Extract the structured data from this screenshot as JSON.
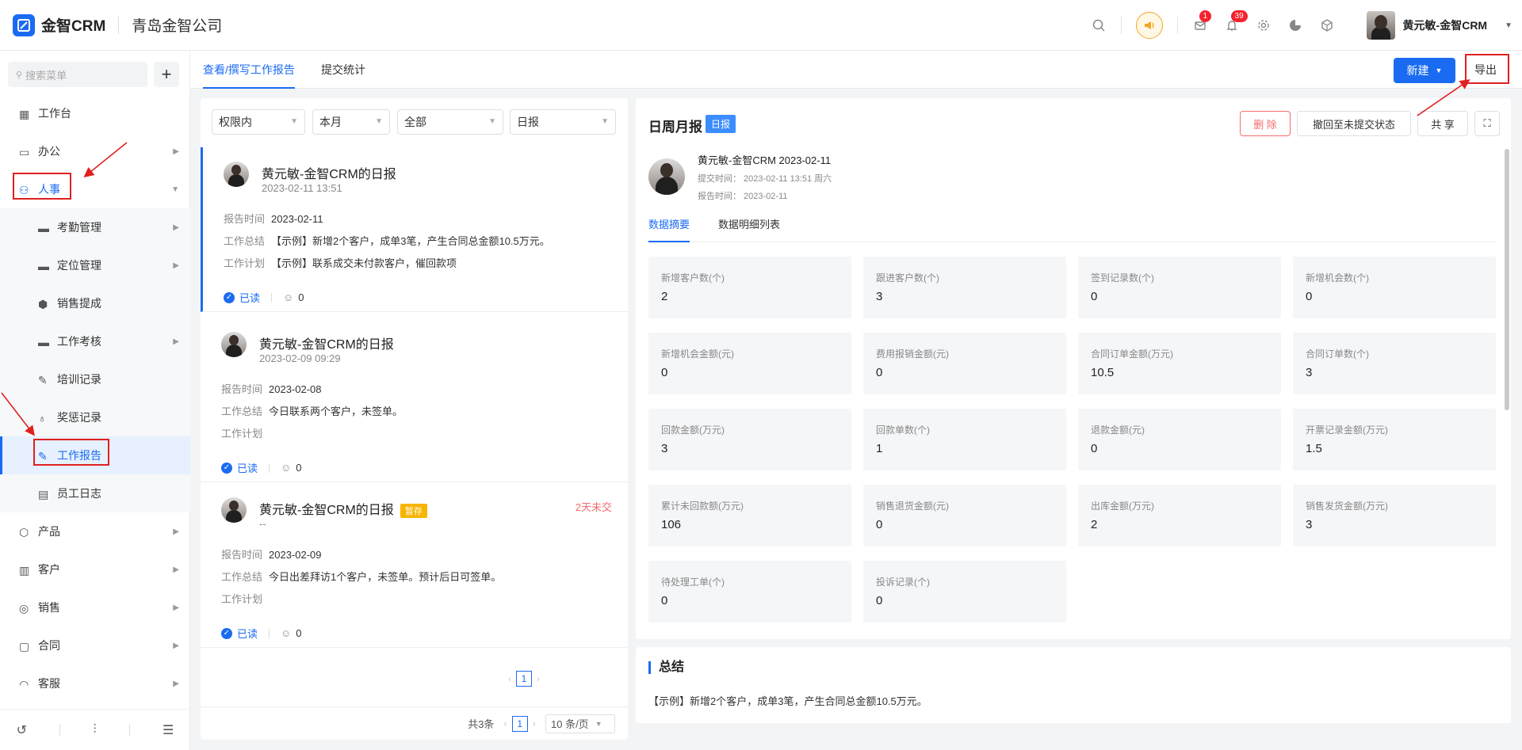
{
  "app": {
    "logo_text": "金智CRM",
    "company": "青岛金智公司"
  },
  "topbar": {
    "badge_msg": "1",
    "badge_notice": "39",
    "user_name": "黄元敏-金智CRM"
  },
  "sidebar": {
    "search_placeholder": "搜索菜单",
    "add": "+",
    "items": [
      {
        "label": "工作台"
      },
      {
        "label": "办公"
      },
      {
        "label": "人事"
      },
      {
        "label": "考勤管理"
      },
      {
        "label": "定位管理"
      },
      {
        "label": "销售提成"
      },
      {
        "label": "工作考核"
      },
      {
        "label": "培训记录"
      },
      {
        "label": "奖惩记录"
      },
      {
        "label": "工作报告"
      },
      {
        "label": "员工日志"
      },
      {
        "label": "产品"
      },
      {
        "label": "客户"
      },
      {
        "label": "销售"
      },
      {
        "label": "合同"
      },
      {
        "label": "客服"
      }
    ]
  },
  "tabs": {
    "view": "查看/撰写工作报告",
    "stats": "提交统计"
  },
  "toolbar": {
    "new_label": "新建",
    "export_label": "导出"
  },
  "filters": {
    "scope": "权限内",
    "period": "本月",
    "status": "全部",
    "type": "日报"
  },
  "reports": [
    {
      "title": "黄元敏-金智CRM的日报",
      "time": "2023-02-11 13:51",
      "report_time_label": "报告时间",
      "report_time": "2023-02-11",
      "summary_label": "工作总结",
      "summary": "【示例】新增2个客户，成单3笔，产生合同总金额10.5万元。",
      "plan_label": "工作计划",
      "plan": "【示例】联系成交未付款客户，催回款项",
      "read": "已读",
      "comments": "0"
    },
    {
      "title": "黄元敏-金智CRM的日报",
      "time": "2023-02-09 09:29",
      "report_time_label": "报告时间",
      "report_time": "2023-02-08",
      "summary_label": "工作总结",
      "summary": "今日联系两个客户，未签单。",
      "plan_label": "工作计划",
      "plan": "",
      "read": "已读",
      "comments": "0"
    },
    {
      "title": "黄元敏-金智CRM的日报",
      "draft": "暂存",
      "overdue": "2天未交",
      "time": "--",
      "report_time_label": "报告时间",
      "report_time": "2023-02-09",
      "summary_label": "工作总结",
      "summary": "今日出差拜访1个客户，未签单。预计后日可签单。",
      "plan_label": "工作计划",
      "plan": "",
      "read": "已读",
      "comments": "0"
    }
  ],
  "pager": {
    "page": "1",
    "total": "共3条",
    "size": "10 条/页"
  },
  "detail": {
    "title": "日周月报",
    "tag": "日报",
    "btn_delete": "删 除",
    "btn_revoke": "撤回至未提交状态",
    "btn_share": "共 享",
    "header": "黄元敏-金智CRM 2023-02-11",
    "submit_time": "提交时间： 2023-02-11 13:51 周六",
    "report_time": "报告时间： 2023-02-11",
    "tab_summary": "数据摘要",
    "tab_list": "数据明细列表",
    "stats": [
      {
        "label": "新增客户数(个)",
        "value": "2"
      },
      {
        "label": "跟进客户数(个)",
        "value": "3"
      },
      {
        "label": "签到记录数(个)",
        "value": "0"
      },
      {
        "label": "新增机会数(个)",
        "value": "0"
      },
      {
        "label": "新增机会金额(元)",
        "value": "0"
      },
      {
        "label": "费用报销金额(元)",
        "value": "0"
      },
      {
        "label": "合同订单金额(万元)",
        "value": "10.5"
      },
      {
        "label": "合同订单数(个)",
        "value": "3"
      },
      {
        "label": "回款金额(万元)",
        "value": "3"
      },
      {
        "label": "回款单数(个)",
        "value": "1"
      },
      {
        "label": "退款金额(元)",
        "value": "0"
      },
      {
        "label": "开票记录金额(万元)",
        "value": "1.5"
      },
      {
        "label": "累计未回款额(万元)",
        "value": "106"
      },
      {
        "label": "销售退货金额(元)",
        "value": "0"
      },
      {
        "label": "出库金额(万元)",
        "value": "2"
      },
      {
        "label": "销售发货金额(万元)",
        "value": "3"
      },
      {
        "label": "待处理工单(个)",
        "value": "0"
      },
      {
        "label": "投诉记录(个)",
        "value": "0"
      }
    ],
    "summary_title": "总结",
    "summary_text": "【示例】新增2个客户，成单3笔，产生合同总金额10.5万元。"
  },
  "colors": {
    "primary": "#1b6bf2",
    "annotation": "#e02020",
    "draft": "#f7b500",
    "danger": "#f56c6c"
  }
}
